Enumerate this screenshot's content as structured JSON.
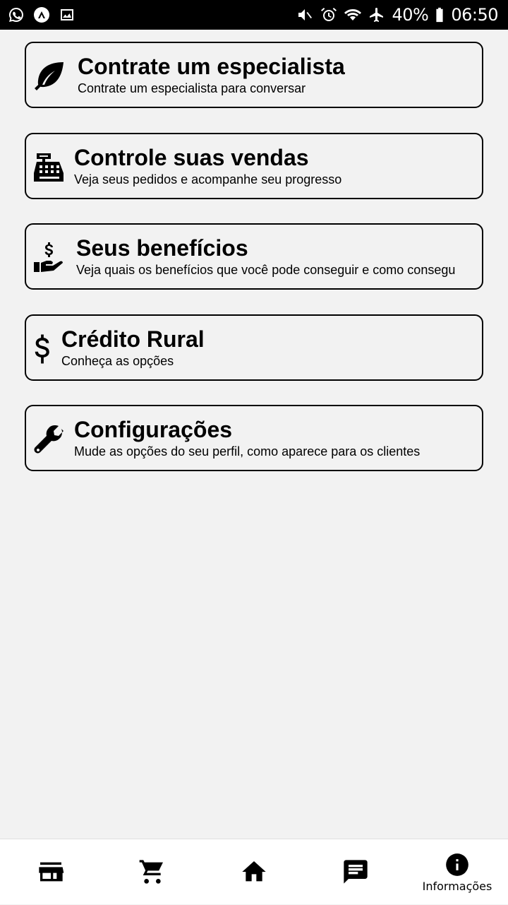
{
  "status_bar": {
    "battery": "40%",
    "time": "06:50",
    "left_icons": [
      "whatsapp-icon",
      "app-icon",
      "gallery-icon"
    ],
    "right_icons": [
      "mute-icon",
      "alarm-icon",
      "wifi-icon",
      "airplane-icon",
      "battery-icon"
    ]
  },
  "menu": {
    "items": [
      {
        "icon": "leaf-icon",
        "title": "Contrate um especialista",
        "subtitle": "Contrate um especialista para conversar"
      },
      {
        "icon": "cash-register-icon",
        "title": "Controle suas vendas",
        "subtitle": "Veja seus pedidos e acompanhe seu progresso"
      },
      {
        "icon": "hand-dollar-icon",
        "title": "Seus benefícios",
        "subtitle": "Veja quais os benefícios que você pode conseguir e como consegu"
      },
      {
        "icon": "dollar-icon",
        "title": "Crédito Rural",
        "subtitle": "Conheça as opções"
      },
      {
        "icon": "wrench-icon",
        "title": "Configurações",
        "subtitle": "Mude as opções do seu perfil, como aparece para os clientes"
      }
    ]
  },
  "bottom_nav": {
    "items": [
      {
        "icon": "store-icon",
        "label": ""
      },
      {
        "icon": "cart-icon",
        "label": ""
      },
      {
        "icon": "home-icon",
        "label": ""
      },
      {
        "icon": "chat-icon",
        "label": ""
      },
      {
        "icon": "info-icon",
        "label": "Informações"
      }
    ],
    "active_index": 4
  }
}
